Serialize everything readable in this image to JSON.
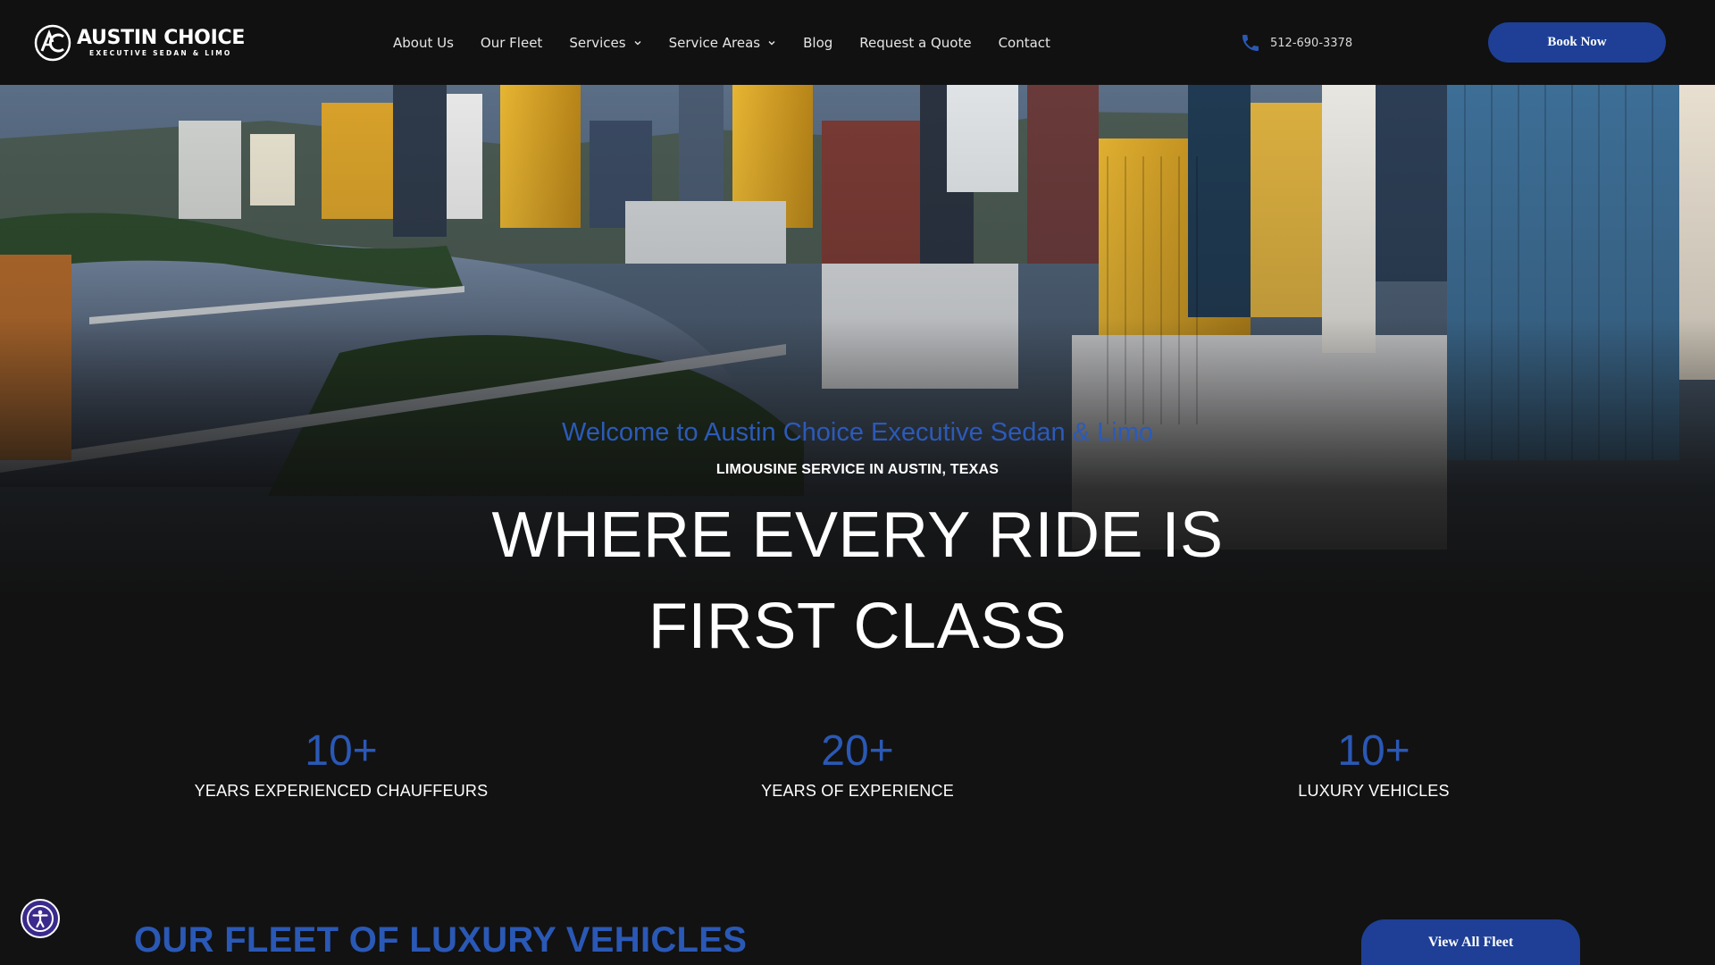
{
  "header": {
    "logo": {
      "name": "AUSTIN CHOICE",
      "sub": "EXECUTIVE SEDAN & LIMO",
      "icon": "ac-monogram-icon"
    },
    "nav": [
      {
        "label": "About Us",
        "dropdown": false
      },
      {
        "label": "Our Fleet",
        "dropdown": false
      },
      {
        "label": "Services",
        "dropdown": true
      },
      {
        "label": "Service Areas",
        "dropdown": true
      },
      {
        "label": "Blog",
        "dropdown": false
      },
      {
        "label": "Request a Quote",
        "dropdown": false
      },
      {
        "label": "Contact",
        "dropdown": false
      }
    ],
    "phone": "512-690-3378",
    "phone_icon": "phone-icon",
    "book_label": "Book Now"
  },
  "hero": {
    "welcome": "Welcome to Austin Choice Executive Sedan & Limo",
    "tagline": "LIMOUSINE SERVICE IN AUSTIN, TEXAS",
    "headline_line1": "WHERE EVERY RIDE IS",
    "headline_line2": "FIRST CLASS"
  },
  "stats": [
    {
      "value": "10+",
      "label": "YEARS EXPERIENCED CHAUFFEURS"
    },
    {
      "value": "20+",
      "label": "YEARS OF EXPERIENCE"
    },
    {
      "value": "10+",
      "label": "LUXURY VEHICLES"
    }
  ],
  "fleet": {
    "title": "OUR FLEET OF LUXURY VEHICLES",
    "button": "View All Fleet"
  },
  "accessibility_icon": "accessibility-icon",
  "colors": {
    "accent": "#1e3f95",
    "accent_text": "#2a58b5",
    "background": "#121212"
  }
}
